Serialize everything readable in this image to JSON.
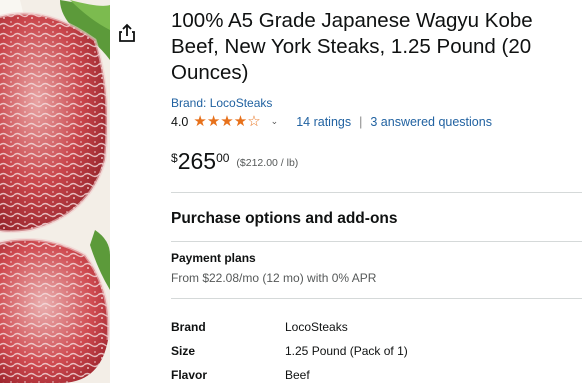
{
  "product": {
    "title": "100% A5 Grade Japanese Wagyu Kobe Beef, New York Steaks, 1.25 Pound (20 Ounces)",
    "brand_link": "Brand: LocoSteaks",
    "rating_value": "4.0",
    "rating_stars": 4,
    "ratings_count": "14 ratings",
    "answered_questions": "3 answered questions",
    "rating_separator": "|",
    "price_symbol": "$",
    "price_whole": "265",
    "price_fraction": "00",
    "unit_price": "($212.00 / lb)"
  },
  "purchase": {
    "heading": "Purchase options and add-ons",
    "payment_plans_title": "Payment plans",
    "payment_plans_text": "From $22.08/mo (12 mo) with 0% APR"
  },
  "specs": [
    {
      "key": "Brand",
      "value": "LocoSteaks"
    },
    {
      "key": "Size",
      "value": "1.25 Pound (Pack of 1)"
    },
    {
      "key": "Flavor",
      "value": "Beef"
    }
  ],
  "icons": {
    "share": "share-icon",
    "stars": "star-icon",
    "chevron": "chevron-down-icon"
  },
  "colors": {
    "link": "#2162a1",
    "star": "#e7711b",
    "text": "#0f1111",
    "muted": "#565959",
    "divider": "#d5d9d9"
  }
}
